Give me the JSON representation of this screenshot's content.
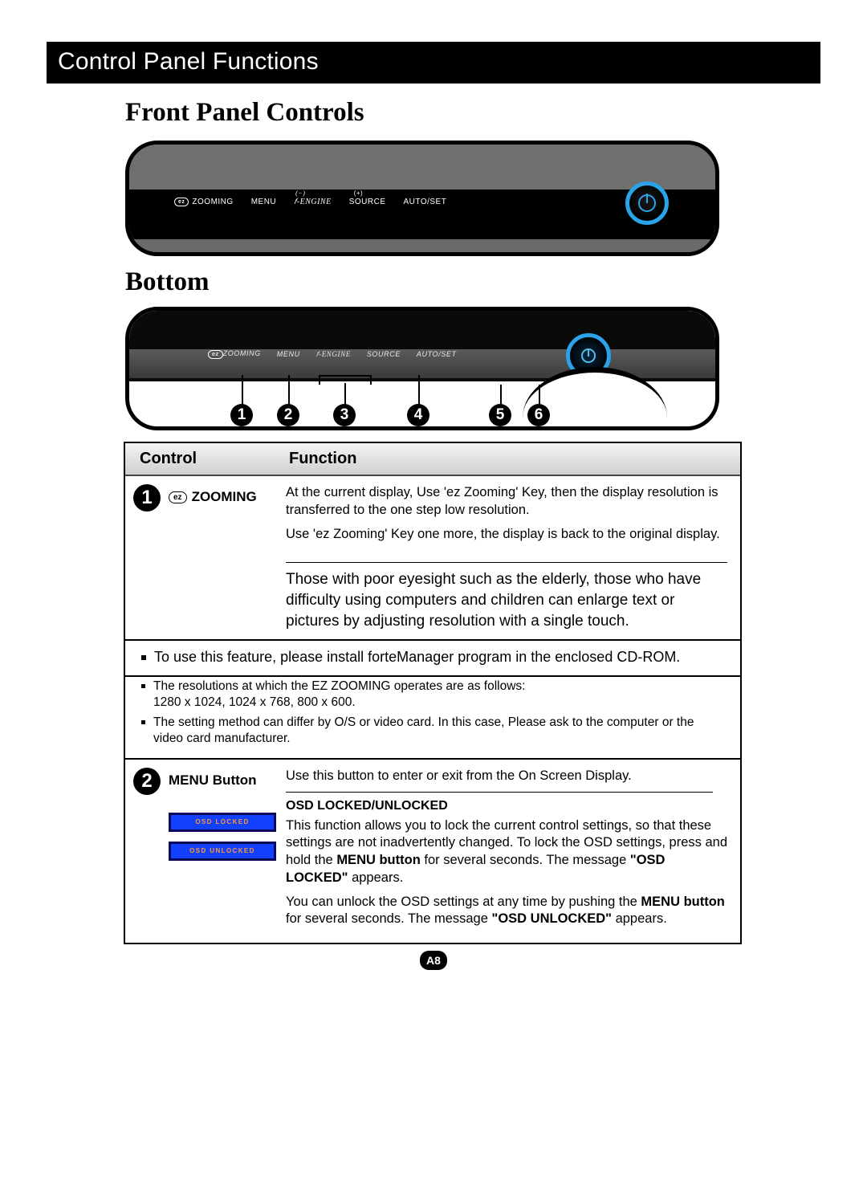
{
  "header": {
    "title": "Control Panel Functions"
  },
  "sections": {
    "front_title": "Front Panel Controls",
    "bottom_title": "Bottom"
  },
  "panel_labels": {
    "zooming": "ZOOMING",
    "menu": "MENU",
    "f_engine": "-ENGINE",
    "source": "SOURCE",
    "autoset": "AUTO/SET",
    "ez_badge": "ez"
  },
  "bottom_labels": {
    "zooming": "ZOOMING",
    "menu": "MENU",
    "f_engine": "-ENGINE",
    "source": "SOURCE",
    "autoset": "AUTO/SET"
  },
  "callout_numbers": [
    "1",
    "2",
    "3",
    "4",
    "5",
    "6"
  ],
  "table": {
    "head_control": "Control",
    "head_function": "Function",
    "row1": {
      "num": "1",
      "control_ez": "ez",
      "control_label": "ZOOMING",
      "func_p1": "At the current display, Use 'ez Zooming' Key, then the display resolution is transferred to the one step low resolution.",
      "func_p2": "Use 'ez Zooming' Key one more, the display is back to the original display.",
      "benefit": "Those with poor eyesight such as the elderly, those who have difficulty using computers and children can enlarge text or pictures by adjusting resolution with a single touch.",
      "note1": "To use this feature, please install forteManager program in the enclosed CD-ROM.",
      "sub1": "The resolutions at which the EZ ZOOMING operates are as follows:",
      "sub1b": "1280 x 1024, 1024 x 768, 800 x 600.",
      "sub2": "The setting method can differ by O/S or video card. In this case, Please ask to the computer or the video card manufacturer."
    },
    "row2": {
      "num": "2",
      "control_label": "MENU Button",
      "func_p1": "Use this button to enter or exit from the On Screen Display.",
      "osd_heading": "OSD LOCKED/UNLOCKED",
      "osd_p1a": "This function allows you to lock the current control settings, so that these settings are not inadvertently changed. To lock the OSD settings, press and hold the ",
      "osd_p1b": "MENU button",
      "osd_p1c": " for several seconds. The message ",
      "osd_p1d": "\"OSD LOCKED\"",
      "osd_p1e": " appears.",
      "osd_p2a": "You can unlock the OSD settings at any time by pushing the ",
      "osd_p2b": "MENU button",
      "osd_p2c": " for several seconds. The message ",
      "osd_p2d": "\"OSD UNLOCKED\"",
      "osd_p2e": " appears.",
      "box_locked": "OSD LOCKED",
      "box_unlocked": "OSD UNLOCKED"
    }
  },
  "page_number": "A8"
}
